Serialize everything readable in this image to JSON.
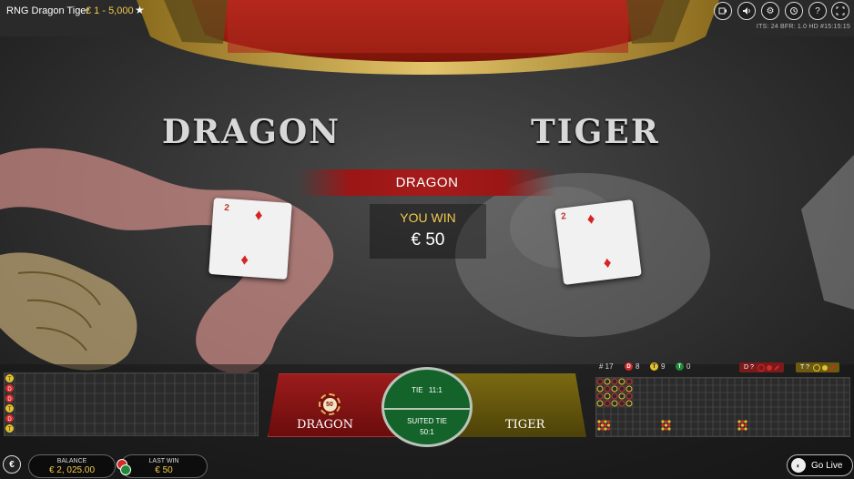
{
  "top_bar": {
    "game_title": "RNG Dragon Tiger",
    "bet_limits": "€ 1 - 5,000",
    "status_info": "ITS: 24 BFR: 1.0   HD   #15:15:15"
  },
  "table": {
    "dragon_heading": "DRAGON",
    "tiger_heading": "TIGER"
  },
  "cards": {
    "dragon": {
      "rank": "2",
      "suit": "diamonds"
    },
    "tiger": {
      "rank": "2",
      "suit": "diamonds"
    }
  },
  "result": {
    "winner": "DRAGON",
    "message": "YOU WIN",
    "amount": "€ 50"
  },
  "stats": {
    "round": "# 17",
    "dragon_label": "D",
    "dragon_count": "8",
    "tiger_label": "T",
    "tiger_count": "9",
    "tie_label": "T",
    "tie_count": "0",
    "predict_dragon": "D ?",
    "predict_tiger": "T ?"
  },
  "left_road": {
    "entries": [
      "T",
      "D",
      "D",
      "T",
      "D",
      "T"
    ]
  },
  "betting": {
    "dragon_label": "DRAGON",
    "tiger_label": "TIGER",
    "tie_label": "TIE",
    "tie_payout": "11:1",
    "suited_tie_label": "SUITED TIE",
    "suited_tie_payout": "50:1",
    "chip_value": "50"
  },
  "bottom_bar": {
    "chip_symbol": "€",
    "balance_label": "BALANCE",
    "balance_value": "€ 2, 025.00",
    "last_win_label": "LAST WIN",
    "last_win_value": "€ 50",
    "go_live_label": "Go Live"
  },
  "colors": {
    "dragon_red": "#d42a2a",
    "tiger_yellow": "#e2c12b",
    "tie_green": "#13632a",
    "gold_text": "#f2c94c"
  },
  "icons": [
    "video-icon",
    "volume-icon",
    "settings-icon",
    "history-icon",
    "help-icon",
    "fullscreen-icon",
    "star-icon",
    "go-live-icon"
  ]
}
